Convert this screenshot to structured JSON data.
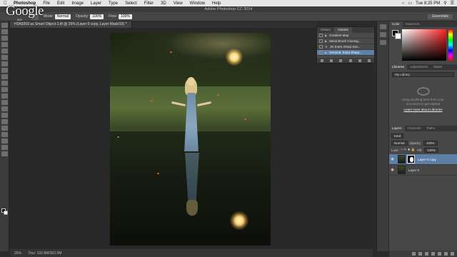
{
  "menubar": {
    "app": "Photoshop",
    "items": [
      "File",
      "Edit",
      "Image",
      "Layer",
      "Type",
      "Select",
      "Filter",
      "3D",
      "View",
      "Window",
      "Help"
    ],
    "clock": "Tue 8:25 PM"
  },
  "overlay": {
    "logo": "Google",
    "sub": "500"
  },
  "titlebar": {
    "title": "Adobe Photoshop CC 2014"
  },
  "options": {
    "mode_label": "Mode:",
    "mode_value": "Normal",
    "opacity_label": "Opacity:",
    "opacity_value": "100%",
    "flow_label": "Flow:",
    "flow_value": "100%",
    "workspace": "Essentials"
  },
  "document": {
    "tab": "H2A9269 as Smart Object-1.tif @ 25% (Layer 0 copy, Layer Mask/16) *",
    "zoom": "25%",
    "doc_size": "Doc: 102.8M/302.0M"
  },
  "actions_panel": {
    "tabs": [
      "History",
      "Actions"
    ],
    "rows": [
      {
        "label": "Gradient Map",
        "selected": false
      },
      {
        "label": "Mesa Brush Cloning...",
        "selected": false
      },
      {
        "label": "JD Extra Sharp Dat...",
        "selected": false
      },
      {
        "label": "General, Extra Sharp...",
        "selected": true
      }
    ]
  },
  "color_panel": {
    "tabs": [
      "Color",
      "Swatches"
    ],
    "accent": "#ff2020"
  },
  "libraries_panel": {
    "tabs": [
      "Libraries",
      "Adjustments",
      "Styles"
    ],
    "select": "My Library",
    "message": "Drag anything here from your document to get started",
    "link": "Learn more about Libraries"
  },
  "layers_panel": {
    "tabs": [
      "Layers",
      "Channels",
      "Paths"
    ],
    "kind": "Kind",
    "blend": "Normal",
    "opacity_label": "Opacity:",
    "opacity_value": "100%",
    "lock_label": "Lock:",
    "fill_label": "Fill:",
    "fill_value": "100%",
    "layers": [
      {
        "name": "Layer 0 copy",
        "selected": true,
        "has_mask": true
      },
      {
        "name": "Layer 0",
        "selected": false,
        "has_mask": false
      }
    ]
  }
}
